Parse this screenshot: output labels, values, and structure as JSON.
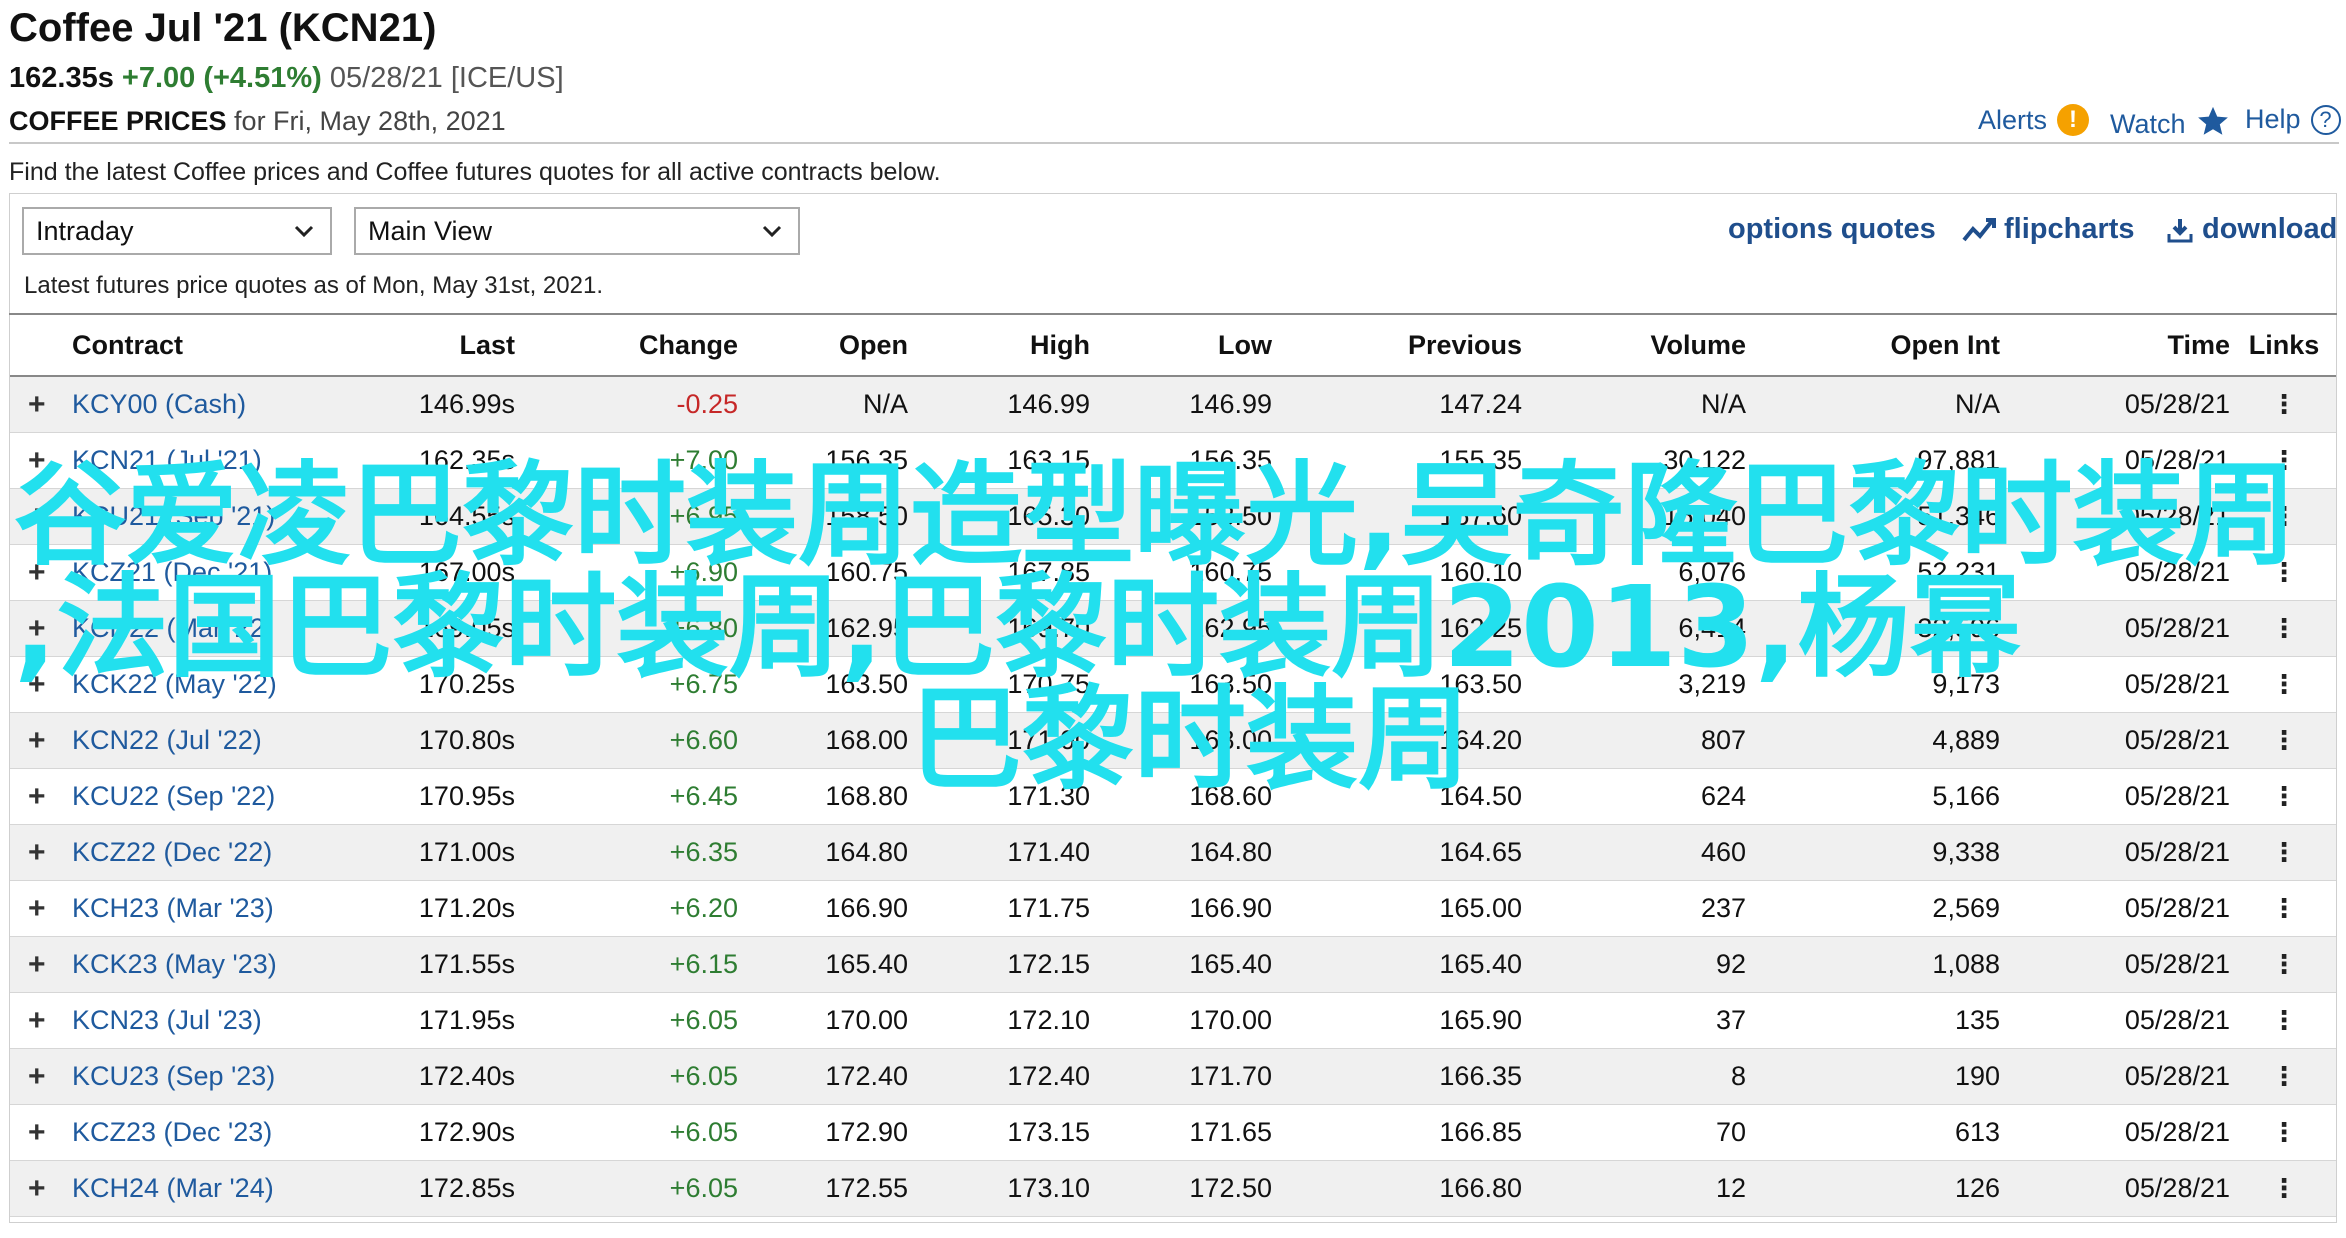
{
  "header": {
    "title": "Coffee Jul '21 (KCN21)",
    "price": "162.35s",
    "change": "+7.00 (+4.51%)",
    "date": "05/28/21",
    "exchange": "[ICE/US]",
    "subtitle_bold": "COFFEE PRICES",
    "subtitle_rest": "for Fri, May 28th, 2021"
  },
  "tools": {
    "alerts": "Alerts",
    "alerts_icon": "!",
    "watch": "Watch",
    "help": "Help",
    "help_icon": "?"
  },
  "description": "Find the latest Coffee prices and Coffee futures quotes for all active contracts below.",
  "controls": {
    "period_select": "Intraday",
    "view_select": "Main View",
    "options_quotes": "options quotes",
    "flipcharts": "flipcharts",
    "download": "download"
  },
  "asof": "Latest futures price quotes as of Mon, May 31st, 2021.",
  "table": {
    "columns": [
      "Contract",
      "Last",
      "Change",
      "Open",
      "High",
      "Low",
      "Previous",
      "Volume",
      "Open Int",
      "Time",
      "Links"
    ],
    "rows": [
      {
        "contract": "KCY00 (Cash)",
        "last": "146.99s",
        "change": "-0.25",
        "open": "N/A",
        "high": "146.99",
        "low": "146.99",
        "previous": "147.24",
        "volume": "N/A",
        "openint": "N/A",
        "time": "05/28/21"
      },
      {
        "contract": "KCN21 (Jul '21)",
        "last": "162.35s",
        "change": "+7.00",
        "open": "156.35",
        "high": "163.15",
        "low": "156.35",
        "previous": "155.35",
        "volume": "30,122",
        "openint": "97,881",
        "time": "05/28/21"
      },
      {
        "contract": "KCU21 (Sep '21)",
        "last": "164.55s",
        "change": "+6.95",
        "open": "158.50",
        "high": "165.30",
        "low": "158.50",
        "previous": "157.60",
        "volume": "15,040",
        "openint": "51,346",
        "time": "05/28/21"
      },
      {
        "contract": "KCZ21 (Dec '21)",
        "last": "167.00s",
        "change": "+6.90",
        "open": "160.75",
        "high": "167.85",
        "low": "160.75",
        "previous": "160.10",
        "volume": "6,076",
        "openint": "52,231",
        "time": "05/28/21"
      },
      {
        "contract": "KCH22 (Mar '22)",
        "last": "169.05s",
        "change": "+6.80",
        "open": "162.95",
        "high": "169.70",
        "low": "162.95",
        "previous": "162.25",
        "volume": "6,414",
        "openint": "32,596",
        "time": "05/28/21"
      },
      {
        "contract": "KCK22 (May '22)",
        "last": "170.25s",
        "change": "+6.75",
        "open": "163.50",
        "high": "170.75",
        "low": "163.50",
        "previous": "163.50",
        "volume": "3,219",
        "openint": "9,173",
        "time": "05/28/21"
      },
      {
        "contract": "KCN22 (Jul '22)",
        "last": "170.80s",
        "change": "+6.60",
        "open": "168.00",
        "high": "171.00",
        "low": "168.00",
        "previous": "164.20",
        "volume": "807",
        "openint": "4,889",
        "time": "05/28/21"
      },
      {
        "contract": "KCU22 (Sep '22)",
        "last": "170.95s",
        "change": "+6.45",
        "open": "168.80",
        "high": "171.30",
        "low": "168.60",
        "previous": "164.50",
        "volume": "624",
        "openint": "5,166",
        "time": "05/28/21"
      },
      {
        "contract": "KCZ22 (Dec '22)",
        "last": "171.00s",
        "change": "+6.35",
        "open": "164.80",
        "high": "171.40",
        "low": "164.80",
        "previous": "164.65",
        "volume": "460",
        "openint": "9,338",
        "time": "05/28/21"
      },
      {
        "contract": "KCH23 (Mar '23)",
        "last": "171.20s",
        "change": "+6.20",
        "open": "166.90",
        "high": "171.75",
        "low": "166.90",
        "previous": "165.00",
        "volume": "237",
        "openint": "2,569",
        "time": "05/28/21"
      },
      {
        "contract": "KCK23 (May '23)",
        "last": "171.55s",
        "change": "+6.15",
        "open": "165.40",
        "high": "172.15",
        "low": "165.40",
        "previous": "165.40",
        "volume": "92",
        "openint": "1,088",
        "time": "05/28/21"
      },
      {
        "contract": "KCN23 (Jul '23)",
        "last": "171.95s",
        "change": "+6.05",
        "open": "170.00",
        "high": "172.10",
        "low": "170.00",
        "previous": "165.90",
        "volume": "37",
        "openint": "135",
        "time": "05/28/21"
      },
      {
        "contract": "KCU23 (Sep '23)",
        "last": "172.40s",
        "change": "+6.05",
        "open": "172.40",
        "high": "172.40",
        "low": "171.70",
        "previous": "166.35",
        "volume": "8",
        "openint": "190",
        "time": "05/28/21"
      },
      {
        "contract": "KCZ23 (Dec '23)",
        "last": "172.90s",
        "change": "+6.05",
        "open": "172.90",
        "high": "173.15",
        "low": "171.65",
        "previous": "166.85",
        "volume": "70",
        "openint": "613",
        "time": "05/28/21"
      },
      {
        "contract": "KCH24 (Mar '24)",
        "last": "172.85s",
        "change": "+6.05",
        "open": "172.55",
        "high": "173.10",
        "low": "172.50",
        "previous": "166.80",
        "volume": "12",
        "openint": "126",
        "time": "05/28/21"
      }
    ]
  },
  "overlay_text": {
    "line1": "谷爱凌巴黎时装周造型曝光,吴奇隆巴黎时装周",
    "line2": ",法国巴黎时装周,巴黎时装周2013,杨幂",
    "line3": "巴黎时装周"
  },
  "colors": {
    "link": "#1f5a9e",
    "positive": "#2e7d32",
    "negative": "#c62828",
    "overlay": "#22e0ee",
    "alert": "#f5a100"
  }
}
